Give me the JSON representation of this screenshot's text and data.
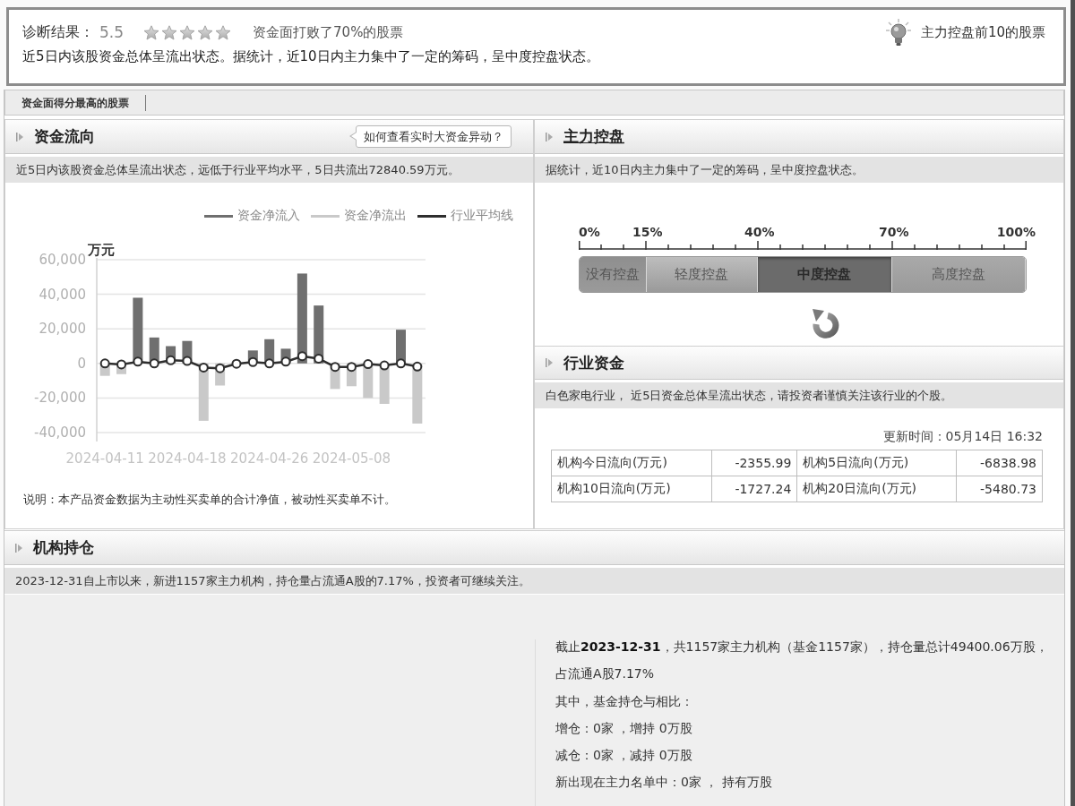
{
  "diagnosis": {
    "label": "诊断结果：",
    "score": "5.5",
    "stars": 0,
    "rank_text": "资金面打败了70%的股票",
    "top_link": "主力控盘前10的股票",
    "summary": "近5日内该股资金总体呈流出状态。据统计，近10日内主力集中了一定的筹码，呈中度控盘状态。"
  },
  "tabs": [
    {
      "label": "资金面得分最高的股票"
    }
  ],
  "fund_flow": {
    "title": "资金流向",
    "title_is_link": false,
    "help_button": "如何查看实时大资金异动？",
    "summary": "近5日内该股资金总体呈流出状态，远低于行业平均水平，5日共流出72840.59万元。",
    "chart_data": {
      "type": "bar",
      "ylabel": "万元",
      "grid": true,
      "legend": "top-right",
      "categories": [
        "2024-04-11",
        null,
        null,
        null,
        null,
        "2024-04-18",
        null,
        null,
        null,
        null,
        "2024-04-26",
        null,
        null,
        null,
        null,
        "2024-05-08",
        null,
        null,
        null,
        null
      ],
      "ylim": [
        -40000,
        60000
      ],
      "yticks": [
        {
          "value": 60000,
          "label": "60,000"
        },
        {
          "value": 40000,
          "label": "40,000"
        },
        {
          "value": 20000,
          "label": "20,000"
        },
        {
          "value": 0,
          "label": "0"
        },
        {
          "value": -20000,
          "label": "-20,000"
        },
        {
          "value": -40000,
          "label": "-40,000"
        }
      ],
      "series": [
        {
          "name": "资金净流入",
          "type": "bar",
          "color": "#6f6f6f",
          "values": [
            0,
            0,
            38000,
            15000,
            10000,
            13000,
            0,
            0,
            0,
            7500,
            14000,
            8500,
            52000,
            33500,
            0,
            0,
            0,
            0,
            19500,
            0
          ]
        },
        {
          "name": "资金净流出",
          "type": "bar",
          "color": "#c9c9c9",
          "values": [
            -7200,
            -6200,
            0,
            0,
            0,
            0,
            -33200,
            -12800,
            0,
            0,
            0,
            0,
            0,
            0,
            -14800,
            -13200,
            -20000,
            -23400,
            0,
            -34800
          ]
        },
        {
          "name": "行业平均线",
          "type": "line",
          "marker": "circle",
          "color": "#2e2e2e",
          "values": [
            0,
            -600,
            1000,
            0,
            1800,
            1400,
            -2400,
            -2800,
            -200,
            800,
            0,
            1000,
            4200,
            2800,
            -2000,
            -2000,
            -400,
            -1200,
            0,
            -1800
          ]
        }
      ]
    },
    "note": "说明：本产品资金数据为主动性买卖单的合计净值，被动性买卖单不计。"
  },
  "main_control": {
    "title": "主力控盘",
    "title_is_link": true,
    "summary": "据统计，近10日内主力集中了一定的筹码，呈中度控盘状态。",
    "scale_labels": [
      "0%",
      "15%",
      "40%",
      "70%",
      "100%"
    ],
    "segments": [
      {
        "label": "没有控盘",
        "selected": false
      },
      {
        "label": "轻度控盘",
        "selected": false
      },
      {
        "label": "中度控盘",
        "selected": true
      },
      {
        "label": "高度控盘",
        "selected": false
      }
    ]
  },
  "industry_fund": {
    "title": "行业资金",
    "title_is_link": false,
    "summary": "白色家电行业， 近5日资金总体呈流出状态，请投资者谨慎关注该行业的个股。",
    "updated": "更新时间：05月14日 16:32",
    "table": {
      "rows": [
        [
          "机构今日流向(万元)",
          "-2355.99",
          "机构5日流向(万元)",
          "-6838.98"
        ],
        [
          "机构10日流向(万元)",
          "-1727.24",
          "机构20日流向(万元)",
          "-5480.73"
        ]
      ]
    }
  },
  "holdings": {
    "title": "机构持仓",
    "title_is_link": false,
    "summary": "2023-12-31自上市以来，新进1157家主力机构，持仓量占流通A股的7.17%，投资者可继续关注。",
    "details": [
      "截止**2023-12-31**，共1157家主力机构（基金1157家），持仓量总计49400.06万股，占流通A股7.17%",
      "其中，基金持仓与相比：",
      "增仓：0家 ，增持 0万股",
      "减仓：0家 ，减持 0万股",
      "新出现在主力名单中：0家 ， 持有万股"
    ]
  }
}
